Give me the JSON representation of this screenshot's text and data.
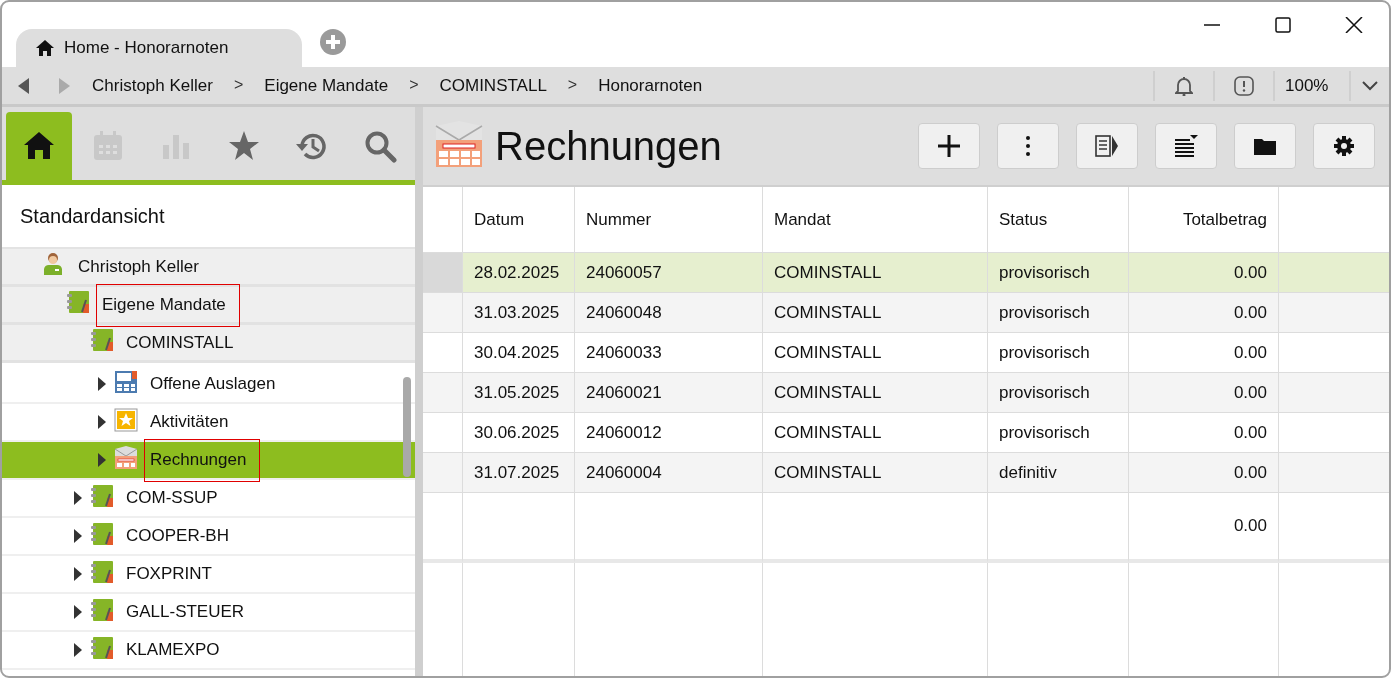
{
  "window": {
    "tab_title": "Home - Honorarnoten"
  },
  "nav": {
    "back_disabled": false,
    "forward_disabled": true,
    "breadcrumbs": [
      {
        "kind": "crumb",
        "text": "Christoph Keller"
      },
      {
        "kind": "separator",
        "text": ">"
      },
      {
        "kind": "crumb",
        "text": "Eigene Mandate"
      },
      {
        "kind": "separator",
        "text": ">"
      },
      {
        "kind": "crumb",
        "text": "COMINSTALL"
      },
      {
        "kind": "separator",
        "text": ">"
      },
      {
        "kind": "crumb",
        "text": "Honorarnoten"
      }
    ],
    "zoom": "100%"
  },
  "sidebar": {
    "tabs": [
      {
        "kind": "home",
        "selected": true,
        "disabled": false
      },
      {
        "kind": "calendar",
        "selected": false,
        "disabled": true
      },
      {
        "kind": "chart",
        "selected": false,
        "disabled": true
      },
      {
        "kind": "star",
        "selected": false,
        "disabled": false
      },
      {
        "kind": "history",
        "selected": false,
        "disabled": false
      },
      {
        "kind": "search",
        "selected": false,
        "disabled": false
      }
    ],
    "view_title": "Standardansicht",
    "tree": [
      {
        "label": "Christoph Keller",
        "kind": "person",
        "pinned": true,
        "selected": false,
        "annotated": false,
        "children": [
          {
            "label": "Eigene Mandate",
            "kind": "notebook",
            "pinned": true,
            "selected": false,
            "annotated": true,
            "children": [
              {
                "label": "COMINSTALL",
                "kind": "notebook",
                "pinned": true,
                "selected": false,
                "annotated": false,
                "children": [
                  {
                    "label": "Offene Auslagen",
                    "kind": "expenses",
                    "pinned": false,
                    "selected": false,
                    "annotated": false,
                    "expanded": false
                  },
                  {
                    "label": "Aktivitäten",
                    "kind": "activities",
                    "pinned": false,
                    "selected": false,
                    "annotated": false,
                    "expanded": false
                  },
                  {
                    "label": "Rechnungen",
                    "kind": "invoices",
                    "pinned": false,
                    "selected": true,
                    "annotated": true,
                    "expanded": false
                  }
                ]
              },
              {
                "label": "COM-SSUP",
                "kind": "notebook",
                "pinned": false,
                "selected": false,
                "annotated": false,
                "expanded": false
              },
              {
                "label": "COOPER-BH",
                "kind": "notebook",
                "pinned": false,
                "selected": false,
                "annotated": false,
                "expanded": false
              },
              {
                "label": "FOXPRINT",
                "kind": "notebook",
                "pinned": false,
                "selected": false,
                "annotated": false,
                "expanded": false
              },
              {
                "label": "GALL-STEUER",
                "kind": "notebook",
                "pinned": false,
                "selected": false,
                "annotated": false,
                "expanded": false
              },
              {
                "label": "KLAMEXPO",
                "kind": "notebook",
                "pinned": false,
                "selected": false,
                "annotated": false,
                "expanded": false
              }
            ]
          }
        ]
      }
    ]
  },
  "main": {
    "title": "Rechnungen",
    "toolbar": [
      {
        "kind": "add"
      },
      {
        "kind": "more"
      },
      {
        "kind": "panel"
      },
      {
        "kind": "list-menu"
      },
      {
        "kind": "folder"
      },
      {
        "kind": "settings"
      }
    ],
    "table": {
      "columns": [
        "Datum",
        "Nummer",
        "Mandat",
        "Status",
        "Totalbetrag"
      ],
      "rows": [
        {
          "selected": true,
          "cells": [
            "28.02.2025",
            "24060057",
            "COMINSTALL",
            "provisorisch",
            "0.00"
          ]
        },
        {
          "selected": false,
          "cells": [
            "31.03.2025",
            "24060048",
            "COMINSTALL",
            "provisorisch",
            "0.00"
          ]
        },
        {
          "selected": false,
          "cells": [
            "30.04.2025",
            "24060033",
            "COMINSTALL",
            "provisorisch",
            "0.00"
          ]
        },
        {
          "selected": false,
          "cells": [
            "31.05.2025",
            "24060021",
            "COMINSTALL",
            "provisorisch",
            "0.00"
          ]
        },
        {
          "selected": false,
          "cells": [
            "30.06.2025",
            "24060012",
            "COMINSTALL",
            "provisorisch",
            "0.00"
          ]
        },
        {
          "selected": false,
          "cells": [
            "31.07.2025",
            "24060004",
            "COMINSTALL",
            "definitiv",
            "0.00"
          ]
        }
      ],
      "total": "0.00"
    }
  }
}
